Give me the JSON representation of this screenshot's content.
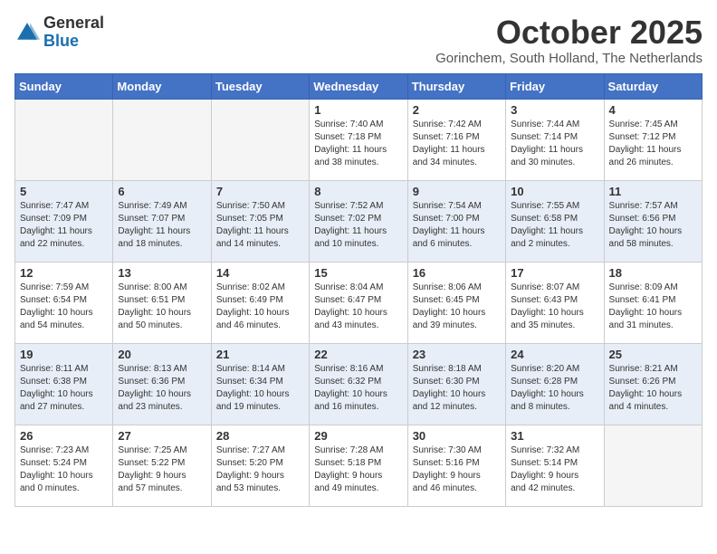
{
  "header": {
    "logo_line1": "General",
    "logo_line2": "Blue",
    "month_title": "October 2025",
    "subtitle": "Gorinchem, South Holland, The Netherlands"
  },
  "days_of_week": [
    "Sunday",
    "Monday",
    "Tuesday",
    "Wednesday",
    "Thursday",
    "Friday",
    "Saturday"
  ],
  "weeks": [
    [
      {
        "day": "",
        "info": ""
      },
      {
        "day": "",
        "info": ""
      },
      {
        "day": "",
        "info": ""
      },
      {
        "day": "1",
        "info": "Sunrise: 7:40 AM\nSunset: 7:18 PM\nDaylight: 11 hours\nand 38 minutes."
      },
      {
        "day": "2",
        "info": "Sunrise: 7:42 AM\nSunset: 7:16 PM\nDaylight: 11 hours\nand 34 minutes."
      },
      {
        "day": "3",
        "info": "Sunrise: 7:44 AM\nSunset: 7:14 PM\nDaylight: 11 hours\nand 30 minutes."
      },
      {
        "day": "4",
        "info": "Sunrise: 7:45 AM\nSunset: 7:12 PM\nDaylight: 11 hours\nand 26 minutes."
      }
    ],
    [
      {
        "day": "5",
        "info": "Sunrise: 7:47 AM\nSunset: 7:09 PM\nDaylight: 11 hours\nand 22 minutes."
      },
      {
        "day": "6",
        "info": "Sunrise: 7:49 AM\nSunset: 7:07 PM\nDaylight: 11 hours\nand 18 minutes."
      },
      {
        "day": "7",
        "info": "Sunrise: 7:50 AM\nSunset: 7:05 PM\nDaylight: 11 hours\nand 14 minutes."
      },
      {
        "day": "8",
        "info": "Sunrise: 7:52 AM\nSunset: 7:02 PM\nDaylight: 11 hours\nand 10 minutes."
      },
      {
        "day": "9",
        "info": "Sunrise: 7:54 AM\nSunset: 7:00 PM\nDaylight: 11 hours\nand 6 minutes."
      },
      {
        "day": "10",
        "info": "Sunrise: 7:55 AM\nSunset: 6:58 PM\nDaylight: 11 hours\nand 2 minutes."
      },
      {
        "day": "11",
        "info": "Sunrise: 7:57 AM\nSunset: 6:56 PM\nDaylight: 10 hours\nand 58 minutes."
      }
    ],
    [
      {
        "day": "12",
        "info": "Sunrise: 7:59 AM\nSunset: 6:54 PM\nDaylight: 10 hours\nand 54 minutes."
      },
      {
        "day": "13",
        "info": "Sunrise: 8:00 AM\nSunset: 6:51 PM\nDaylight: 10 hours\nand 50 minutes."
      },
      {
        "day": "14",
        "info": "Sunrise: 8:02 AM\nSunset: 6:49 PM\nDaylight: 10 hours\nand 46 minutes."
      },
      {
        "day": "15",
        "info": "Sunrise: 8:04 AM\nSunset: 6:47 PM\nDaylight: 10 hours\nand 43 minutes."
      },
      {
        "day": "16",
        "info": "Sunrise: 8:06 AM\nSunset: 6:45 PM\nDaylight: 10 hours\nand 39 minutes."
      },
      {
        "day": "17",
        "info": "Sunrise: 8:07 AM\nSunset: 6:43 PM\nDaylight: 10 hours\nand 35 minutes."
      },
      {
        "day": "18",
        "info": "Sunrise: 8:09 AM\nSunset: 6:41 PM\nDaylight: 10 hours\nand 31 minutes."
      }
    ],
    [
      {
        "day": "19",
        "info": "Sunrise: 8:11 AM\nSunset: 6:38 PM\nDaylight: 10 hours\nand 27 minutes."
      },
      {
        "day": "20",
        "info": "Sunrise: 8:13 AM\nSunset: 6:36 PM\nDaylight: 10 hours\nand 23 minutes."
      },
      {
        "day": "21",
        "info": "Sunrise: 8:14 AM\nSunset: 6:34 PM\nDaylight: 10 hours\nand 19 minutes."
      },
      {
        "day": "22",
        "info": "Sunrise: 8:16 AM\nSunset: 6:32 PM\nDaylight: 10 hours\nand 16 minutes."
      },
      {
        "day": "23",
        "info": "Sunrise: 8:18 AM\nSunset: 6:30 PM\nDaylight: 10 hours\nand 12 minutes."
      },
      {
        "day": "24",
        "info": "Sunrise: 8:20 AM\nSunset: 6:28 PM\nDaylight: 10 hours\nand 8 minutes."
      },
      {
        "day": "25",
        "info": "Sunrise: 8:21 AM\nSunset: 6:26 PM\nDaylight: 10 hours\nand 4 minutes."
      }
    ],
    [
      {
        "day": "26",
        "info": "Sunrise: 7:23 AM\nSunset: 5:24 PM\nDaylight: 10 hours\nand 0 minutes."
      },
      {
        "day": "27",
        "info": "Sunrise: 7:25 AM\nSunset: 5:22 PM\nDaylight: 9 hours\nand 57 minutes."
      },
      {
        "day": "28",
        "info": "Sunrise: 7:27 AM\nSunset: 5:20 PM\nDaylight: 9 hours\nand 53 minutes."
      },
      {
        "day": "29",
        "info": "Sunrise: 7:28 AM\nSunset: 5:18 PM\nDaylight: 9 hours\nand 49 minutes."
      },
      {
        "day": "30",
        "info": "Sunrise: 7:30 AM\nSunset: 5:16 PM\nDaylight: 9 hours\nand 46 minutes."
      },
      {
        "day": "31",
        "info": "Sunrise: 7:32 AM\nSunset: 5:14 PM\nDaylight: 9 hours\nand 42 minutes."
      },
      {
        "day": "",
        "info": ""
      }
    ]
  ],
  "colors": {
    "header_bg": "#4472c4",
    "header_text": "#ffffff",
    "odd_row": "#ffffff",
    "even_row": "#dce6f1",
    "empty_cell": "#f5f5f5"
  }
}
